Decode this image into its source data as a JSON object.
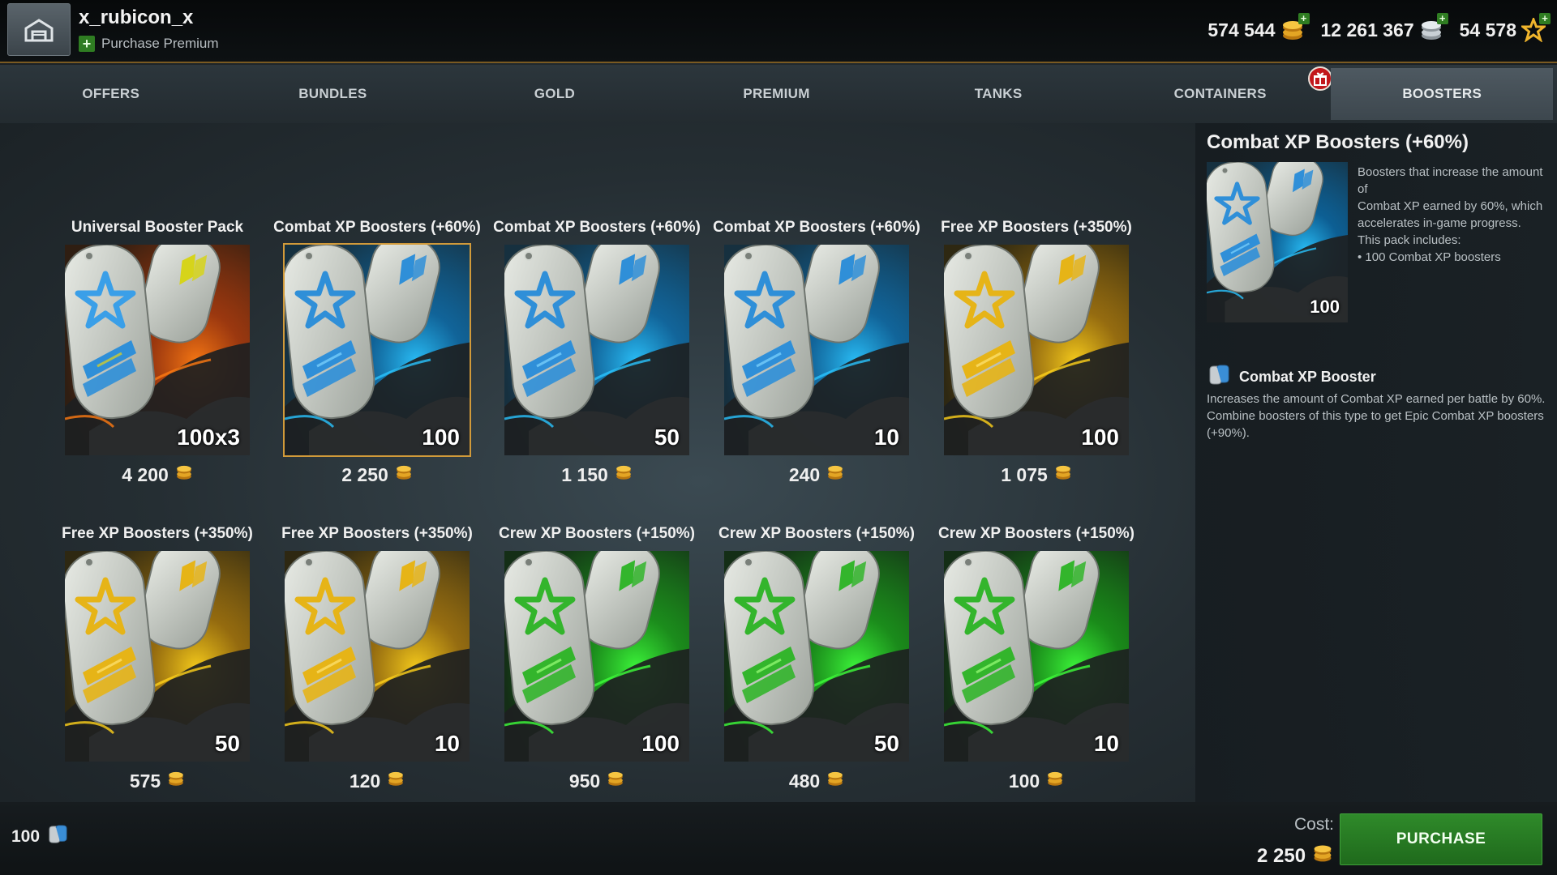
{
  "header": {
    "username": "x_rubicon_x",
    "premium_label": "Purchase Premium",
    "currencies": [
      {
        "name": "gold",
        "value": "574 544",
        "icon": "gold-coins-icon"
      },
      {
        "name": "credits",
        "value": "12 261 367",
        "icon": "silver-credits-icon"
      },
      {
        "name": "free-xp",
        "value": "54 578",
        "icon": "star-xp-icon"
      }
    ]
  },
  "nav": {
    "tabs": [
      {
        "label": "OFFERS"
      },
      {
        "label": "BUNDLES"
      },
      {
        "label": "GOLD"
      },
      {
        "label": "PREMIUM"
      },
      {
        "label": "TANKS"
      },
      {
        "label": "CONTAINERS"
      },
      {
        "label": "BOOSTERS",
        "active": true
      }
    ]
  },
  "cards": [
    {
      "title": "Universal Booster Pack",
      "qty": "100x3",
      "price": "4 200",
      "theme": "universal"
    },
    {
      "title": "Combat XP Boosters (+60%)",
      "qty": "100",
      "price": "2 250",
      "theme": "blue",
      "selected": true
    },
    {
      "title": "Combat XP Boosters (+60%)",
      "qty": "50",
      "price": "1 150",
      "theme": "blue"
    },
    {
      "title": "Combat XP Boosters (+60%)",
      "qty": "10",
      "price": "240",
      "theme": "blue"
    },
    {
      "title": "Free XP Boosters (+350%)",
      "qty": "100",
      "price": "1 075",
      "theme": "gold"
    },
    {
      "title": "Free XP Boosters (+350%)",
      "qty": "50",
      "price": "575",
      "theme": "gold"
    },
    {
      "title": "Free XP Boosters (+350%)",
      "qty": "10",
      "price": "120",
      "theme": "gold"
    },
    {
      "title": "Crew XP Boosters (+150%)",
      "qty": "100",
      "price": "950",
      "theme": "green"
    },
    {
      "title": "Crew XP Boosters (+150%)",
      "qty": "50",
      "price": "480",
      "theme": "green"
    },
    {
      "title": "Crew XP Boosters (+150%)",
      "qty": "10",
      "price": "100",
      "theme": "green"
    }
  ],
  "details": {
    "title": "Combat XP Boosters (+60%)",
    "qty": "100",
    "desc_lines": [
      "Boosters that increase the amount of",
      "Combat XP earned by 60%, which",
      "accelerates in-game progress.",
      "This pack includes:",
      "• 100 Combat XP boosters"
    ],
    "sub_title": "Combat XP Booster",
    "sub_desc_lines": [
      "Increases the amount of Combat XP earned per battle by 60%.",
      "Combine boosters of this type to get Epic Combat XP boosters",
      "(+90%)."
    ]
  },
  "footer": {
    "owned_count": "100",
    "cost_label": "Cost:",
    "cost_value": "2 250",
    "purchase_label": "PURCHASE"
  },
  "colors": {
    "accent_gold": "#d19a3a",
    "purchase_green": "#2f8a2a",
    "gift_red": "#c2171b"
  }
}
